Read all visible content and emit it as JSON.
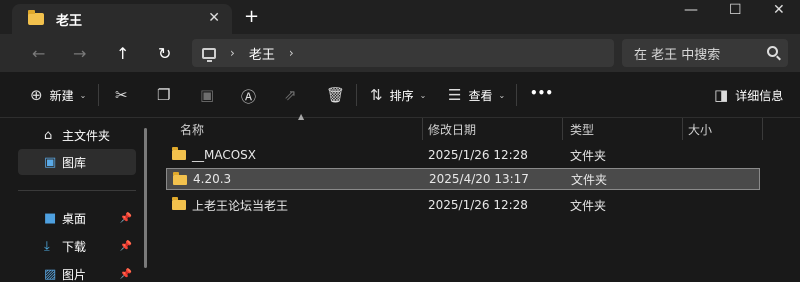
{
  "tab": {
    "title": "老王",
    "close": "✕",
    "new_tab": "+"
  },
  "window_controls": {
    "minimize": "—",
    "maximize": "☐",
    "close": "✕"
  },
  "address": {
    "back": "←",
    "forward": "→",
    "up": "↑",
    "refresh": "↻",
    "sep1": "›",
    "crumb": "老王",
    "sep2": "›",
    "search_placeholder": "在 老王 中搜索"
  },
  "toolbar": {
    "new_label": "新建",
    "sort_label": "排序",
    "view_label": "查看",
    "more": "•••",
    "details_label": "详细信息",
    "caret": "⌄"
  },
  "sidebar": {
    "items": [
      {
        "label": "主文件夹",
        "icon": "home-icon"
      },
      {
        "label": "图库",
        "icon": "gallery-icon"
      },
      {
        "label": "桌面",
        "icon": "desktop-icon"
      },
      {
        "label": "下载",
        "icon": "download-icon"
      },
      {
        "label": "图片",
        "icon": "pictures-icon"
      }
    ],
    "pin": "📌"
  },
  "columns": {
    "name": "名称",
    "date": "修改日期",
    "type": "类型",
    "size": "大小",
    "sort_arrow": "▲"
  },
  "files": [
    {
      "name": "__MACOSX",
      "date": "2025/1/26 12:28",
      "type": "文件夹",
      "size": ""
    },
    {
      "name": "4.20.3",
      "date": "2025/4/20 13:17",
      "type": "文件夹",
      "size": ""
    },
    {
      "name": "上老王论坛当老王",
      "date": "2025/1/26 12:28",
      "type": "文件夹",
      "size": ""
    }
  ],
  "colors": {
    "folder": "#f2c14d",
    "selection": "#4a4a4a",
    "background": "#191919"
  }
}
